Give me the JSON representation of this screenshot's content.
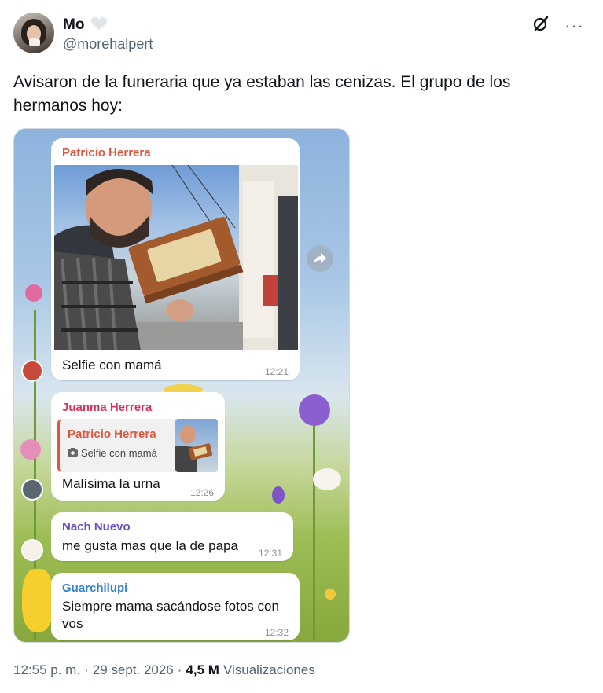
{
  "author": {
    "display_name": "Mo",
    "handle": "@morehalpert"
  },
  "tweet": {
    "text": "Avisaron de la funeraria que ya estaban las cenizas. El grupo de los hermanos hoy:"
  },
  "chat": {
    "messages": [
      {
        "sender": "Patricio Herrera",
        "sender_color": "#d8593f",
        "text": "Selfie con mamá",
        "time": "12:21"
      },
      {
        "sender": "Juanma Herrera",
        "sender_color": "#d6335a",
        "reply_to_sender": "Patricio Herrera",
        "reply_to_text": "Selfie con mamá",
        "text": "Malísima la urna",
        "time": "12:26"
      },
      {
        "sender": "Nach Nuevo",
        "sender_color": "#6a4fc4",
        "text": "me gusta mas que la de papa",
        "time": "12:31"
      },
      {
        "sender": "Guarchilupi",
        "sender_color": "#2f80c9",
        "text_line1": "Siempre mama sacándose fotos con",
        "text_line2": "vos",
        "time": "12:32"
      }
    ]
  },
  "meta": {
    "time": "12:55 p. m.",
    "separator": "·",
    "date": "29 sept. 2026",
    "views_count": "4,5 M",
    "views_label": "Visualizaciones"
  },
  "icons": [
    "heart-icon",
    "grok-icon",
    "more-icon",
    "share-forward-icon",
    "camera-icon"
  ]
}
